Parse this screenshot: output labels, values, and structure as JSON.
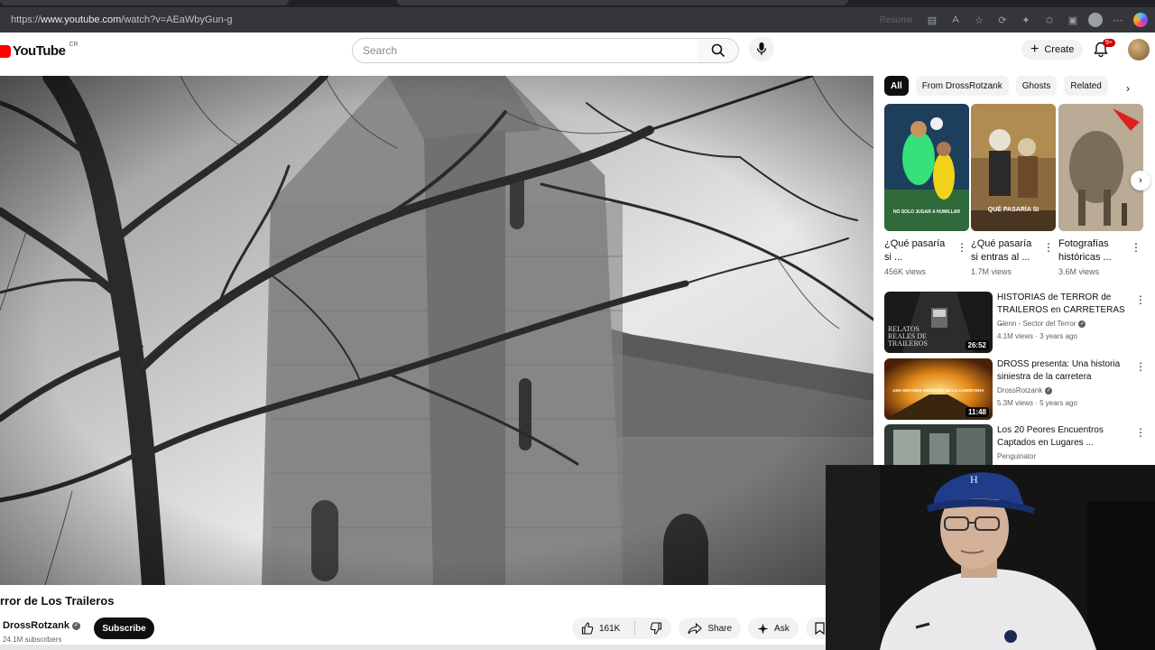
{
  "browser": {
    "url_prefix": "https://",
    "url_host": "www.youtube.com",
    "url_path": "/watch?v=AEaWbyGun-g",
    "summarize_label": "Resumir"
  },
  "header": {
    "logo_text": "YouTube",
    "country_code": "CR",
    "search_placeholder": "Search",
    "create_label": "Create",
    "notifications_badge": "9+"
  },
  "video": {
    "title": "rror de Los Traileros",
    "channel_name": "DrossRotzank",
    "subscribers": "24.1M subscribers",
    "subscribe_label": "Subscribe",
    "likes": "161K",
    "share_label": "Share",
    "ask_label": "Ask",
    "save_label": "Sa"
  },
  "sidebar": {
    "chips": [
      "All",
      "From DrossRotzank",
      "Ghosts",
      "Related"
    ],
    "shorts": [
      {
        "title": "¿Qué pasaría si ...",
        "views": "456K views",
        "overlay": "NO SOLO JUGAR A HUMILLAR"
      },
      {
        "title": "¿Qué pasaría si entras al ...",
        "views": "1.7M views",
        "overlay": "QUÉ PASARÍA SI"
      },
      {
        "title": "Fotografías históricas ...",
        "views": "3.6M views",
        "overlay": ""
      }
    ],
    "recommendations": [
      {
        "title": "HISTORIAS de TERROR de TRAILEROS en CARRETERAS ...",
        "channel": "Glenn - Sector del Terror",
        "meta": "4.1M views · 3 years ago",
        "duration": "26:52",
        "thumb_text": "RELATOS REALES DE TRAILEROS"
      },
      {
        "title": "DROSS presenta: Una historia siniestra de la carretera",
        "channel": "DrossRotzank",
        "meta": "5.3M views · 5 years ago",
        "duration": "11:48",
        "thumb_text": "UNA HISTORIA SINIESTRA DE LA CARRETERA"
      },
      {
        "title": "Los 20 Peores Encuentros Captados en Lugares ...",
        "channel": "Penguinator",
        "meta": "",
        "duration": "",
        "thumb_text": ""
      }
    ]
  },
  "colors": {
    "accent_red": "#ff0000",
    "badge_red": "#cc0000",
    "text_primary": "#0f0f0f",
    "text_secondary": "#606060",
    "chip_bg": "#f2f2f2"
  }
}
